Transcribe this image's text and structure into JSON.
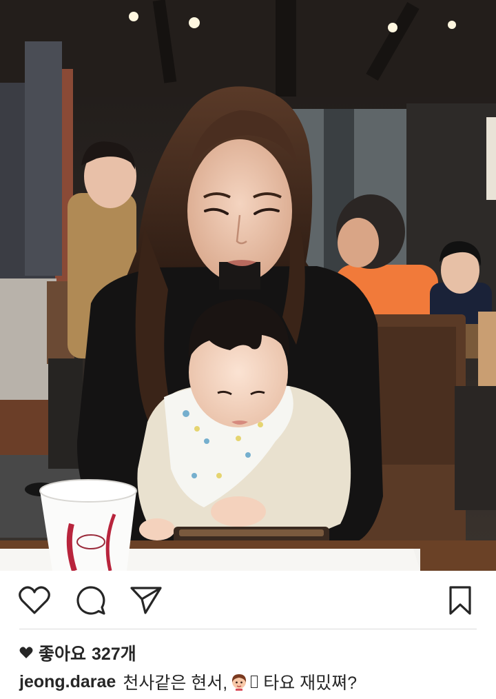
{
  "post": {
    "photo_description_icon": "photo",
    "actions": {
      "like_icon": "heart-outline-icon",
      "comment_icon": "comment-bubble-icon",
      "share_icon": "paper-plane-icon",
      "save_icon": "bookmark-icon"
    },
    "likes": {
      "label": "좋아요",
      "count": "327개"
    },
    "caption": {
      "username": "jeong.darae",
      "text_part1": "천사같은 현서,",
      "text_part2": "타요 재밌쪄?"
    }
  },
  "colors": {
    "text": "#262626",
    "divider": "#dbdbdb",
    "background": "#ffffff"
  }
}
